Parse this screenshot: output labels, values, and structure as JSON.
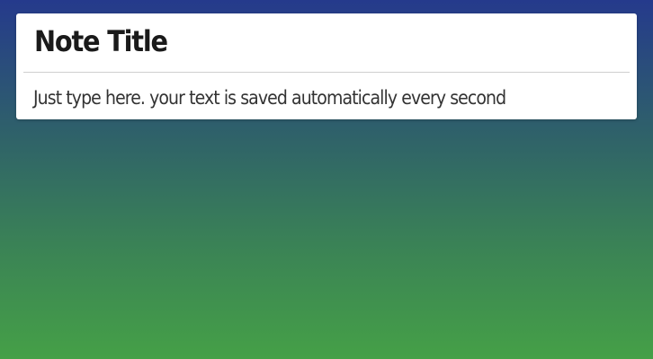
{
  "note": {
    "title": "Note Title",
    "body": "Just type here. your text is saved automatically every second"
  },
  "colors": {
    "background_top": "#253a8c",
    "background_bottom": "#45a047",
    "card": "#ffffff",
    "title_text": "#1a1a1a",
    "body_text": "#333333"
  }
}
